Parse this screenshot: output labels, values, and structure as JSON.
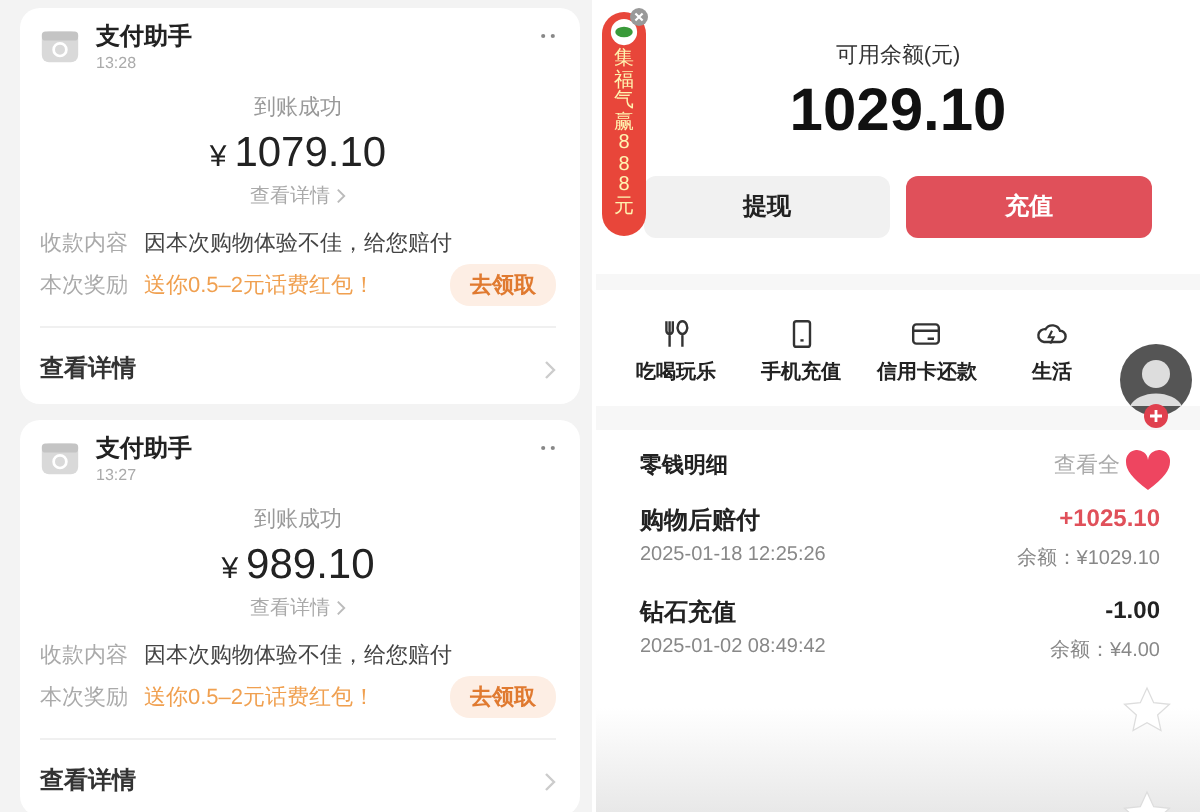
{
  "payment_cards": [
    {
      "title": "支付助手",
      "time": "13:28",
      "status": "到账成功",
      "currency": "¥",
      "amount": "1079.10",
      "detail_link": "查看详情",
      "rows": [
        {
          "kind": "text",
          "label": "收款内容",
          "value": "因本次购物体验不佳，给您赔付"
        },
        {
          "kind": "promo",
          "label": "本次奖励",
          "value": "送你0.5–2元话费红包！",
          "action": "去领取"
        }
      ],
      "footer_link": "查看详情"
    },
    {
      "title": "支付助手",
      "time": "13:27",
      "status": "到账成功",
      "currency": "¥",
      "amount": "989.10",
      "detail_link": "查看详情",
      "rows": [
        {
          "kind": "text",
          "label": "收款内容",
          "value": "因本次购物体验不佳，给您赔付"
        },
        {
          "kind": "promo",
          "label": "本次奖励",
          "value": "送你0.5–2元话费红包！",
          "action": "去领取"
        }
      ],
      "footer_link": "查看详情"
    }
  ],
  "wallet": {
    "balance_label": "可用余额(元)",
    "balance": "1029.10",
    "buttons": [
      {
        "kind": "secondary",
        "label": "提现"
      },
      {
        "kind": "primary",
        "label": "充值"
      }
    ],
    "shortcuts": [
      {
        "label": "吃喝玩乐"
      },
      {
        "label": "手机充值"
      },
      {
        "label": "信用卡还款"
      },
      {
        "label": "生活"
      }
    ],
    "details": {
      "title": "零钱明细",
      "view_all": "查看全",
      "entries": [
        {
          "kind": "credit",
          "name": "购物后赔付",
          "amount": "+1025.10",
          "date": "2025-01-18 12:25:26",
          "balance": "余额：¥1029.10"
        },
        {
          "kind": "debit",
          "name": "钻石充值",
          "amount": "-1.00",
          "date": "2025-01-02 08:49:42",
          "balance": "余额：¥4.00"
        }
      ]
    }
  },
  "promo_banner": {
    "text": "集福气赢888元"
  }
}
